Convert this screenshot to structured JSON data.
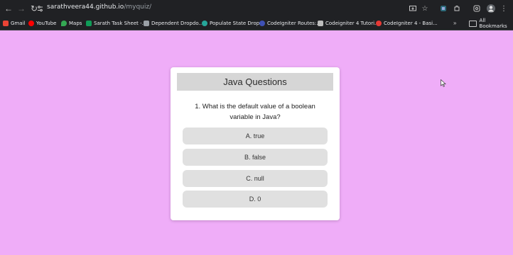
{
  "browser": {
    "url_host": "sarathveera44.github.io",
    "url_path": "/myquiz/",
    "bookmarks": [
      {
        "label": "Gmail",
        "icon": "gmail-icon",
        "color": "#ea4335"
      },
      {
        "label": "YouTube",
        "icon": "youtube-icon",
        "color": "#ff0000"
      },
      {
        "label": "Maps",
        "icon": "maps-icon",
        "color": "#34a853"
      },
      {
        "label": "Sarath Task Sheet -...",
        "icon": "sheets-icon",
        "color": "#0f9d58"
      },
      {
        "label": "Dependent Dropdo...",
        "icon": "page-icon",
        "color": "#9aa0a6"
      },
      {
        "label": "Populate State Drop...",
        "icon": "page-icon",
        "color": "#26a69a"
      },
      {
        "label": "CodeIgniter Routes:...",
        "icon": "page-icon",
        "color": "#3f51b5"
      },
      {
        "label": "Codeigniter 4 Tutori...",
        "icon": "page-icon",
        "color": "#bdbdbd"
      },
      {
        "label": "CodeIgniter 4 - Basi...",
        "icon": "page-icon",
        "color": "#e53935"
      }
    ],
    "all_bookmarks": "All Bookmarks",
    "more_chevron": "»"
  },
  "quiz": {
    "title": "Java Questions",
    "question": "1. What is the default value of a boolean variable in Java?",
    "options": [
      "A. true",
      "B. false",
      "C. null",
      "D. 0"
    ]
  }
}
